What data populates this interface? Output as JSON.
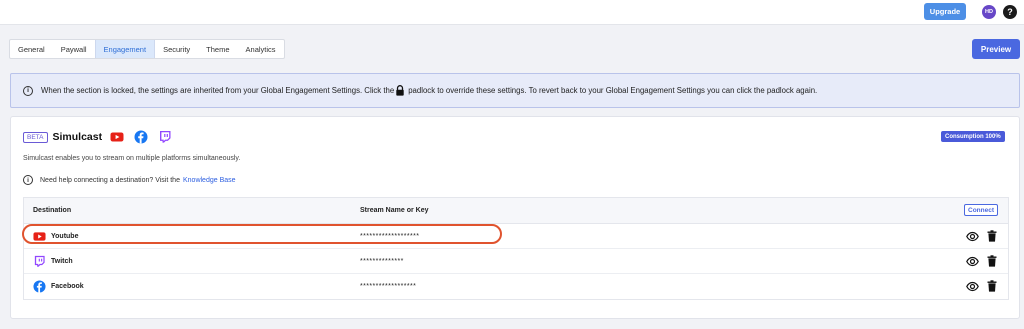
{
  "topbar": {
    "upgrade_label": "Upgrade",
    "avatar_initials": "HD",
    "help_label": "?"
  },
  "tabs": [
    "General",
    "Paywall",
    "Engagement",
    "Security",
    "Theme",
    "Analytics"
  ],
  "active_tab": "Engagement",
  "preview_label": "Preview",
  "banner": {
    "text_before": "When the section is locked, the settings are inherited from your Global Engagement Settings. Click the",
    "text_after": "padlock to override these settings. To revert back to your Global Engagement Settings you can click the padlock again."
  },
  "simulcast": {
    "beta_label": "BETA",
    "title": "Simulcast",
    "consumption_label": "Consumption 100%",
    "description": "Simulcast enables you to stream on multiple platforms simultaneously.",
    "help_text": "Need help connecting a destination? Visit the",
    "help_link": "Knowledge Base",
    "table": {
      "col_destination": "Destination",
      "col_stream_key": "Stream Name or Key",
      "connect_label": "Connect",
      "rows": [
        {
          "name": "Youtube",
          "key": "*******************"
        },
        {
          "name": "Twitch",
          "key": "**************"
        },
        {
          "name": "Facebook",
          "key": "******************"
        }
      ]
    }
  },
  "colors": {
    "accent": "#4a68e0",
    "highlight": "#e0532e",
    "youtube": "#e62117",
    "facebook": "#1877f2",
    "twitch": "#9146ff"
  },
  "icons": [
    "info-icon",
    "lock-icon",
    "youtube-icon",
    "facebook-icon",
    "twitch-icon",
    "eye-icon",
    "trash-icon"
  ]
}
